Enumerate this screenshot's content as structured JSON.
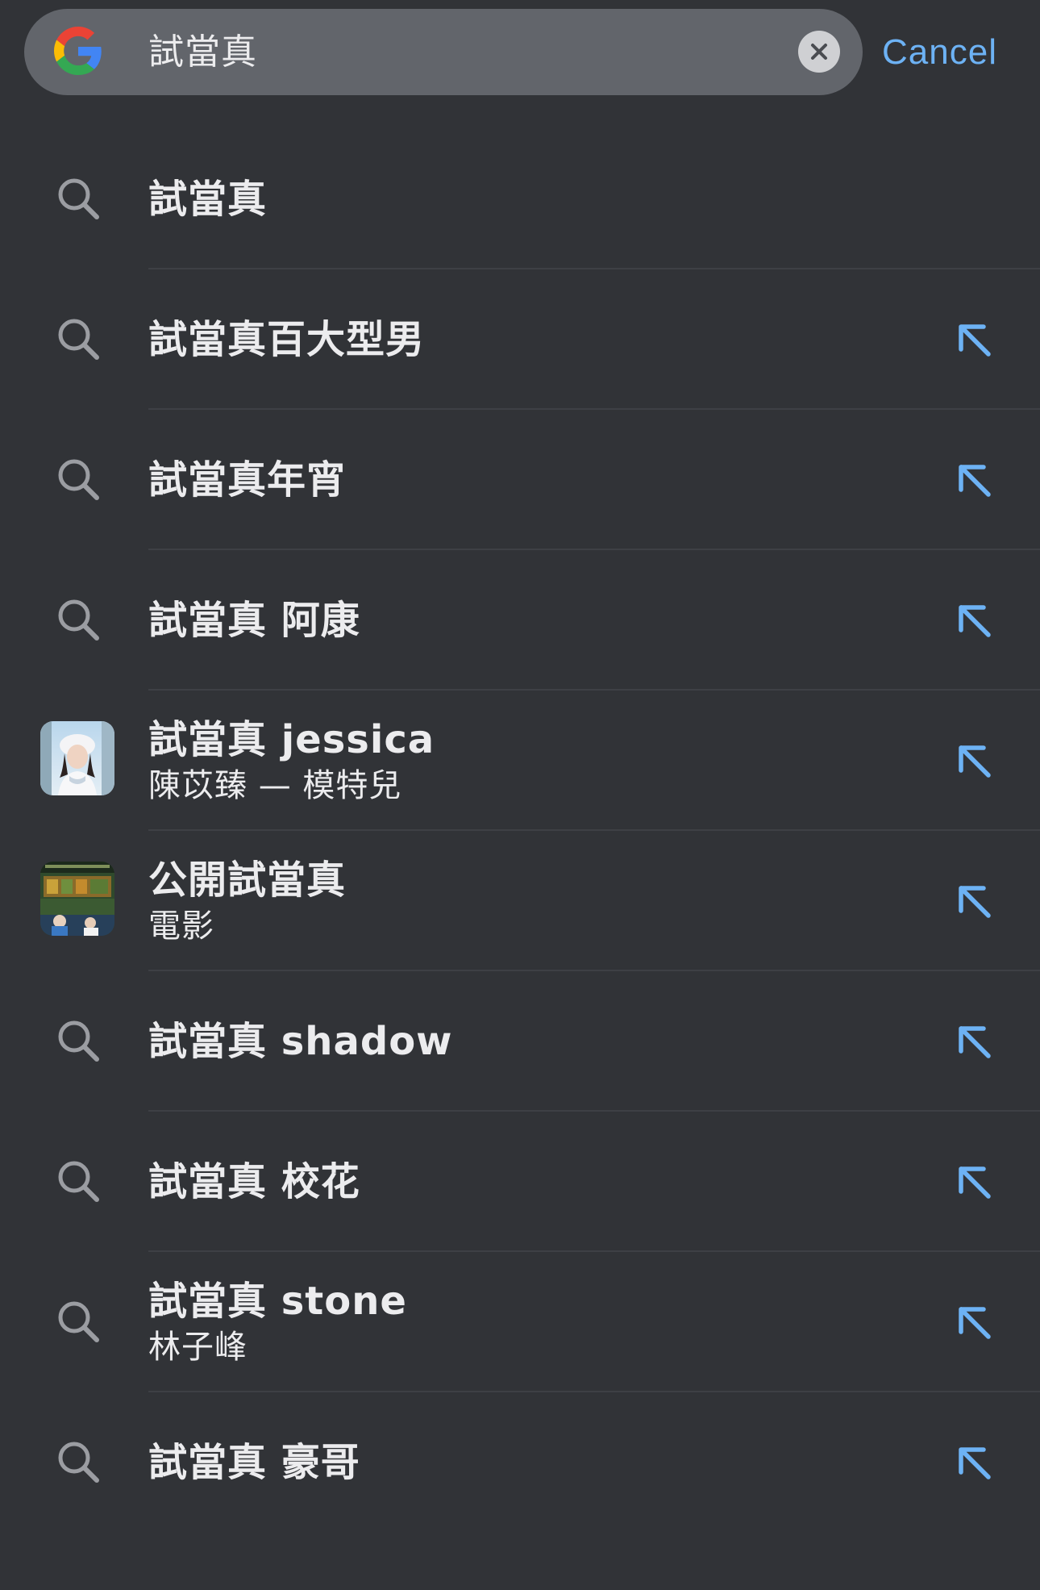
{
  "search": {
    "engine_icon": "google-g-icon",
    "query": "試當真",
    "clear_icon": "close-icon",
    "cancel_label": "Cancel"
  },
  "colors": {
    "background": "#313337",
    "search_pill": "#62656b",
    "accent": "#6db2f4",
    "text": "#ececee"
  },
  "suggestions": [
    {
      "type": "query",
      "title": "試當真",
      "subtitle": "",
      "icon": "search-icon",
      "fill_arrow": false
    },
    {
      "type": "query",
      "title": "試當真百大型男",
      "subtitle": "",
      "icon": "search-icon",
      "fill_arrow": true
    },
    {
      "type": "query",
      "title": "試當真年宵",
      "subtitle": "",
      "icon": "search-icon",
      "fill_arrow": true
    },
    {
      "type": "query",
      "title": "試當真 阿康",
      "subtitle": "",
      "icon": "search-icon",
      "fill_arrow": true
    },
    {
      "type": "entity",
      "title": "試當真 jessica",
      "subtitle": "陳苡臻 — 模特兒",
      "icon": "person-thumbnail",
      "fill_arrow": true
    },
    {
      "type": "entity",
      "title": "公開試當真",
      "subtitle": "電影",
      "icon": "movie-thumbnail",
      "fill_arrow": true
    },
    {
      "type": "query",
      "title": "試當真 shadow",
      "subtitle": "",
      "icon": "search-icon",
      "fill_arrow": true
    },
    {
      "type": "query",
      "title": "試當真 校花",
      "subtitle": "",
      "icon": "search-icon",
      "fill_arrow": true
    },
    {
      "type": "query",
      "title": "試當真 stone",
      "subtitle": "林子峰",
      "icon": "search-icon",
      "fill_arrow": true
    },
    {
      "type": "query",
      "title": "試當真 豪哥",
      "subtitle": "",
      "icon": "search-icon",
      "fill_arrow": true
    }
  ]
}
